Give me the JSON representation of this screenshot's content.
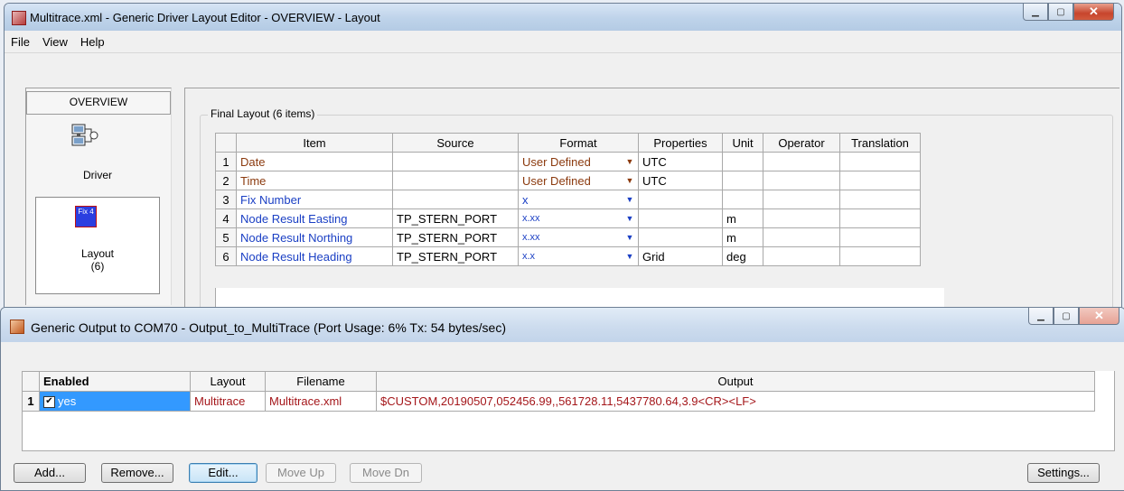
{
  "window1": {
    "title": "Multitrace.xml - Generic Driver Layout Editor -  OVERVIEW -  Layout",
    "menu": [
      "File",
      "View",
      "Help"
    ],
    "sidebar": {
      "header": "OVERVIEW",
      "items": [
        {
          "label": "Driver",
          "icon": "driver-icon"
        },
        {
          "label": "Layout",
          "count": "(6)",
          "icon": "layout-icon",
          "icon_text": "Fix 4"
        }
      ]
    },
    "group_label": "Final Layout (6 items)",
    "columns": [
      "Item",
      "Source",
      "Format",
      "Properties",
      "Unit",
      "Operator",
      "Translation"
    ],
    "rows": [
      {
        "n": "1",
        "item": "Date",
        "source": "",
        "format": "User Defined",
        "properties": "UTC",
        "unit": "",
        "operator": "",
        "translation": ""
      },
      {
        "n": "2",
        "item": "Time",
        "source": "",
        "format": "User Defined",
        "properties": "UTC",
        "unit": "",
        "operator": "",
        "translation": ""
      },
      {
        "n": "3",
        "item": "Fix Number",
        "source": "",
        "format": "x",
        "properties": "",
        "unit": "",
        "operator": "",
        "translation": ""
      },
      {
        "n": "4",
        "item": "Node Result Easting",
        "source": "TP_STERN_PORT",
        "format": "x.xx",
        "properties": "",
        "unit": "m",
        "operator": "",
        "translation": ""
      },
      {
        "n": "5",
        "item": "Node Result Northing",
        "source": "TP_STERN_PORT",
        "format": "x.xx",
        "properties": "",
        "unit": "m",
        "operator": "",
        "translation": ""
      },
      {
        "n": "6",
        "item": "Node Result Heading",
        "source": "TP_STERN_PORT",
        "format": "x.x",
        "properties": "Grid",
        "unit": "deg",
        "operator": "",
        "translation": ""
      }
    ]
  },
  "window2": {
    "title": "Generic Output to COM70 - Output_to_MultiTrace   (Port Usage: 6% Tx: 54 bytes/sec)",
    "columns": [
      "Enabled",
      "Layout",
      "Filename",
      "Output"
    ],
    "rows": [
      {
        "n": "1",
        "enabled": "yes",
        "checked": true,
        "layout": "Multitrace",
        "filename": "Multitrace.xml",
        "output": "$CUSTOM,20190507,052456.99,,561728.11,5437780.64,3.9<CR><LF>"
      }
    ],
    "buttons": {
      "add": "Add...",
      "remove": "Remove...",
      "edit": "Edit...",
      "move_up": "Move Up",
      "move_dn": "Move Dn",
      "settings": "Settings..."
    }
  },
  "colors": {
    "item_brown": "#8b3a0e",
    "item_blue": "#1a3fc4",
    "selection": "#3399ff",
    "output_red": "#a4161a"
  }
}
